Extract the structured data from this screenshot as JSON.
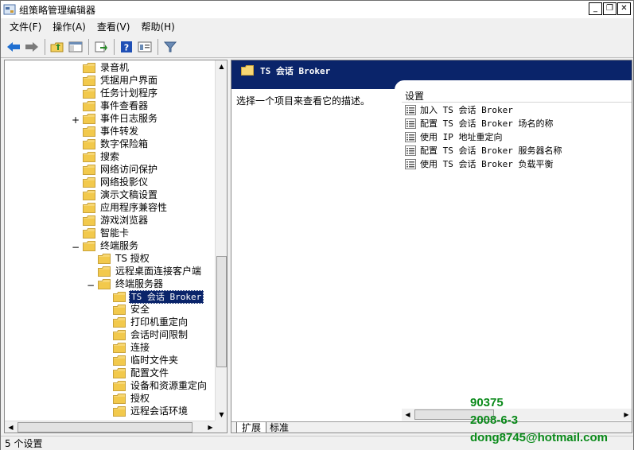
{
  "window": {
    "title": "组策略管理编辑器",
    "buttons": {
      "minimize": "_",
      "restore": "❐",
      "close": "✕"
    }
  },
  "menu": [
    {
      "label": "文件(F)"
    },
    {
      "label": "操作(A)"
    },
    {
      "label": "查看(V)"
    },
    {
      "label": "帮助(H)"
    }
  ],
  "toolbar": {
    "icons": [
      "back-arrow-icon",
      "forward-arrow-icon",
      "up-folder-icon",
      "show-hide-tree-icon",
      "export-list-icon",
      "help-icon",
      "properties-icon",
      "filter-icon"
    ],
    "colors": {
      "back": "#1f6fd1",
      "forward": "#7a7a7a",
      "help": "#1f4fb5",
      "filter": "#6a8bb5"
    }
  },
  "tree": {
    "items": [
      {
        "label": "录音机",
        "level": 0
      },
      {
        "label": "凭据用户界面",
        "level": 0
      },
      {
        "label": "任务计划程序",
        "level": 0
      },
      {
        "label": "事件查看器",
        "level": 0
      },
      {
        "label": "事件日志服务",
        "level": 0,
        "expander": "+"
      },
      {
        "label": "事件转发",
        "level": 0
      },
      {
        "label": "数字保险箱",
        "level": 0
      },
      {
        "label": "搜索",
        "level": 0
      },
      {
        "label": "网络访问保护",
        "level": 0
      },
      {
        "label": "网络投影仪",
        "level": 0
      },
      {
        "label": "演示文稿设置",
        "level": 0
      },
      {
        "label": "应用程序兼容性",
        "level": 0
      },
      {
        "label": "游戏浏览器",
        "level": 0
      },
      {
        "label": "智能卡",
        "level": 0
      },
      {
        "label": "终端服务",
        "level": 0,
        "expander": "−"
      },
      {
        "label": "TS 授权",
        "level": 1
      },
      {
        "label": "远程桌面连接客户端",
        "level": 1
      },
      {
        "label": "终端服务器",
        "level": 1,
        "expander": "−"
      },
      {
        "label": "TS 会话 Broker",
        "level": 2,
        "selected": true
      },
      {
        "label": "安全",
        "level": 2
      },
      {
        "label": "打印机重定向",
        "level": 2
      },
      {
        "label": "会话时间限制",
        "level": 2
      },
      {
        "label": "连接",
        "level": 2
      },
      {
        "label": "临时文件夹",
        "level": 2
      },
      {
        "label": "配置文件",
        "level": 2
      },
      {
        "label": "设备和资源重定向",
        "level": 2
      },
      {
        "label": "授权",
        "level": 2
      },
      {
        "label": "远程会话环境",
        "level": 2
      }
    ],
    "selected_color": "#0a246a"
  },
  "details": {
    "title": "TS 会话 Broker",
    "description": "选择一个项目来查看它的描述。",
    "column_header": "设置",
    "settings": [
      {
        "label": "加入 TS  会话 Broker"
      },
      {
        "label": "配置 TS 会话 Broker 场名的称"
      },
      {
        "label": "使用 IP 地址重定向"
      },
      {
        "label": "配置 TS 会话 Broker 服务器名称"
      },
      {
        "label": "使用 TS 会话 Broker 负载平衡"
      }
    ],
    "header_color": "#0a246a"
  },
  "tabs": [
    {
      "label": "扩展",
      "active": true
    },
    {
      "label": "标准",
      "active": false
    }
  ],
  "status": {
    "text": "5 个设置"
  },
  "watermark": {
    "lines": [
      "90375",
      "2008-6-3",
      "dong8745@hotmail.com"
    ],
    "color": "#0a8a1a"
  }
}
